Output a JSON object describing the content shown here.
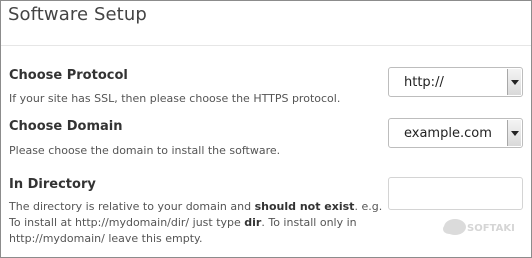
{
  "header": {
    "title": "Software Setup"
  },
  "protocol": {
    "label": "Choose Protocol",
    "hint": "If your site has SSL, then please choose the HTTPS protocol.",
    "selected": "http://"
  },
  "domain": {
    "label": "Choose Domain",
    "hint": "Please choose the domain to install the software.",
    "selected": "example.com"
  },
  "directory": {
    "label": "In Directory",
    "hint_line1_a": "The directory is relative to your domain and ",
    "hint_line1_bold": "should not exist",
    "hint_line1_b": ". e.g.",
    "hint_line2_a": "To install at http://mydomain/dir/ just type ",
    "hint_line2_bold": "dir",
    "hint_line2_b": ". To install only in",
    "hint_line3": "http://mydomain/ leave this empty.",
    "value": "",
    "placeholder": ""
  },
  "watermark": {
    "text": "SOFTAKI"
  }
}
